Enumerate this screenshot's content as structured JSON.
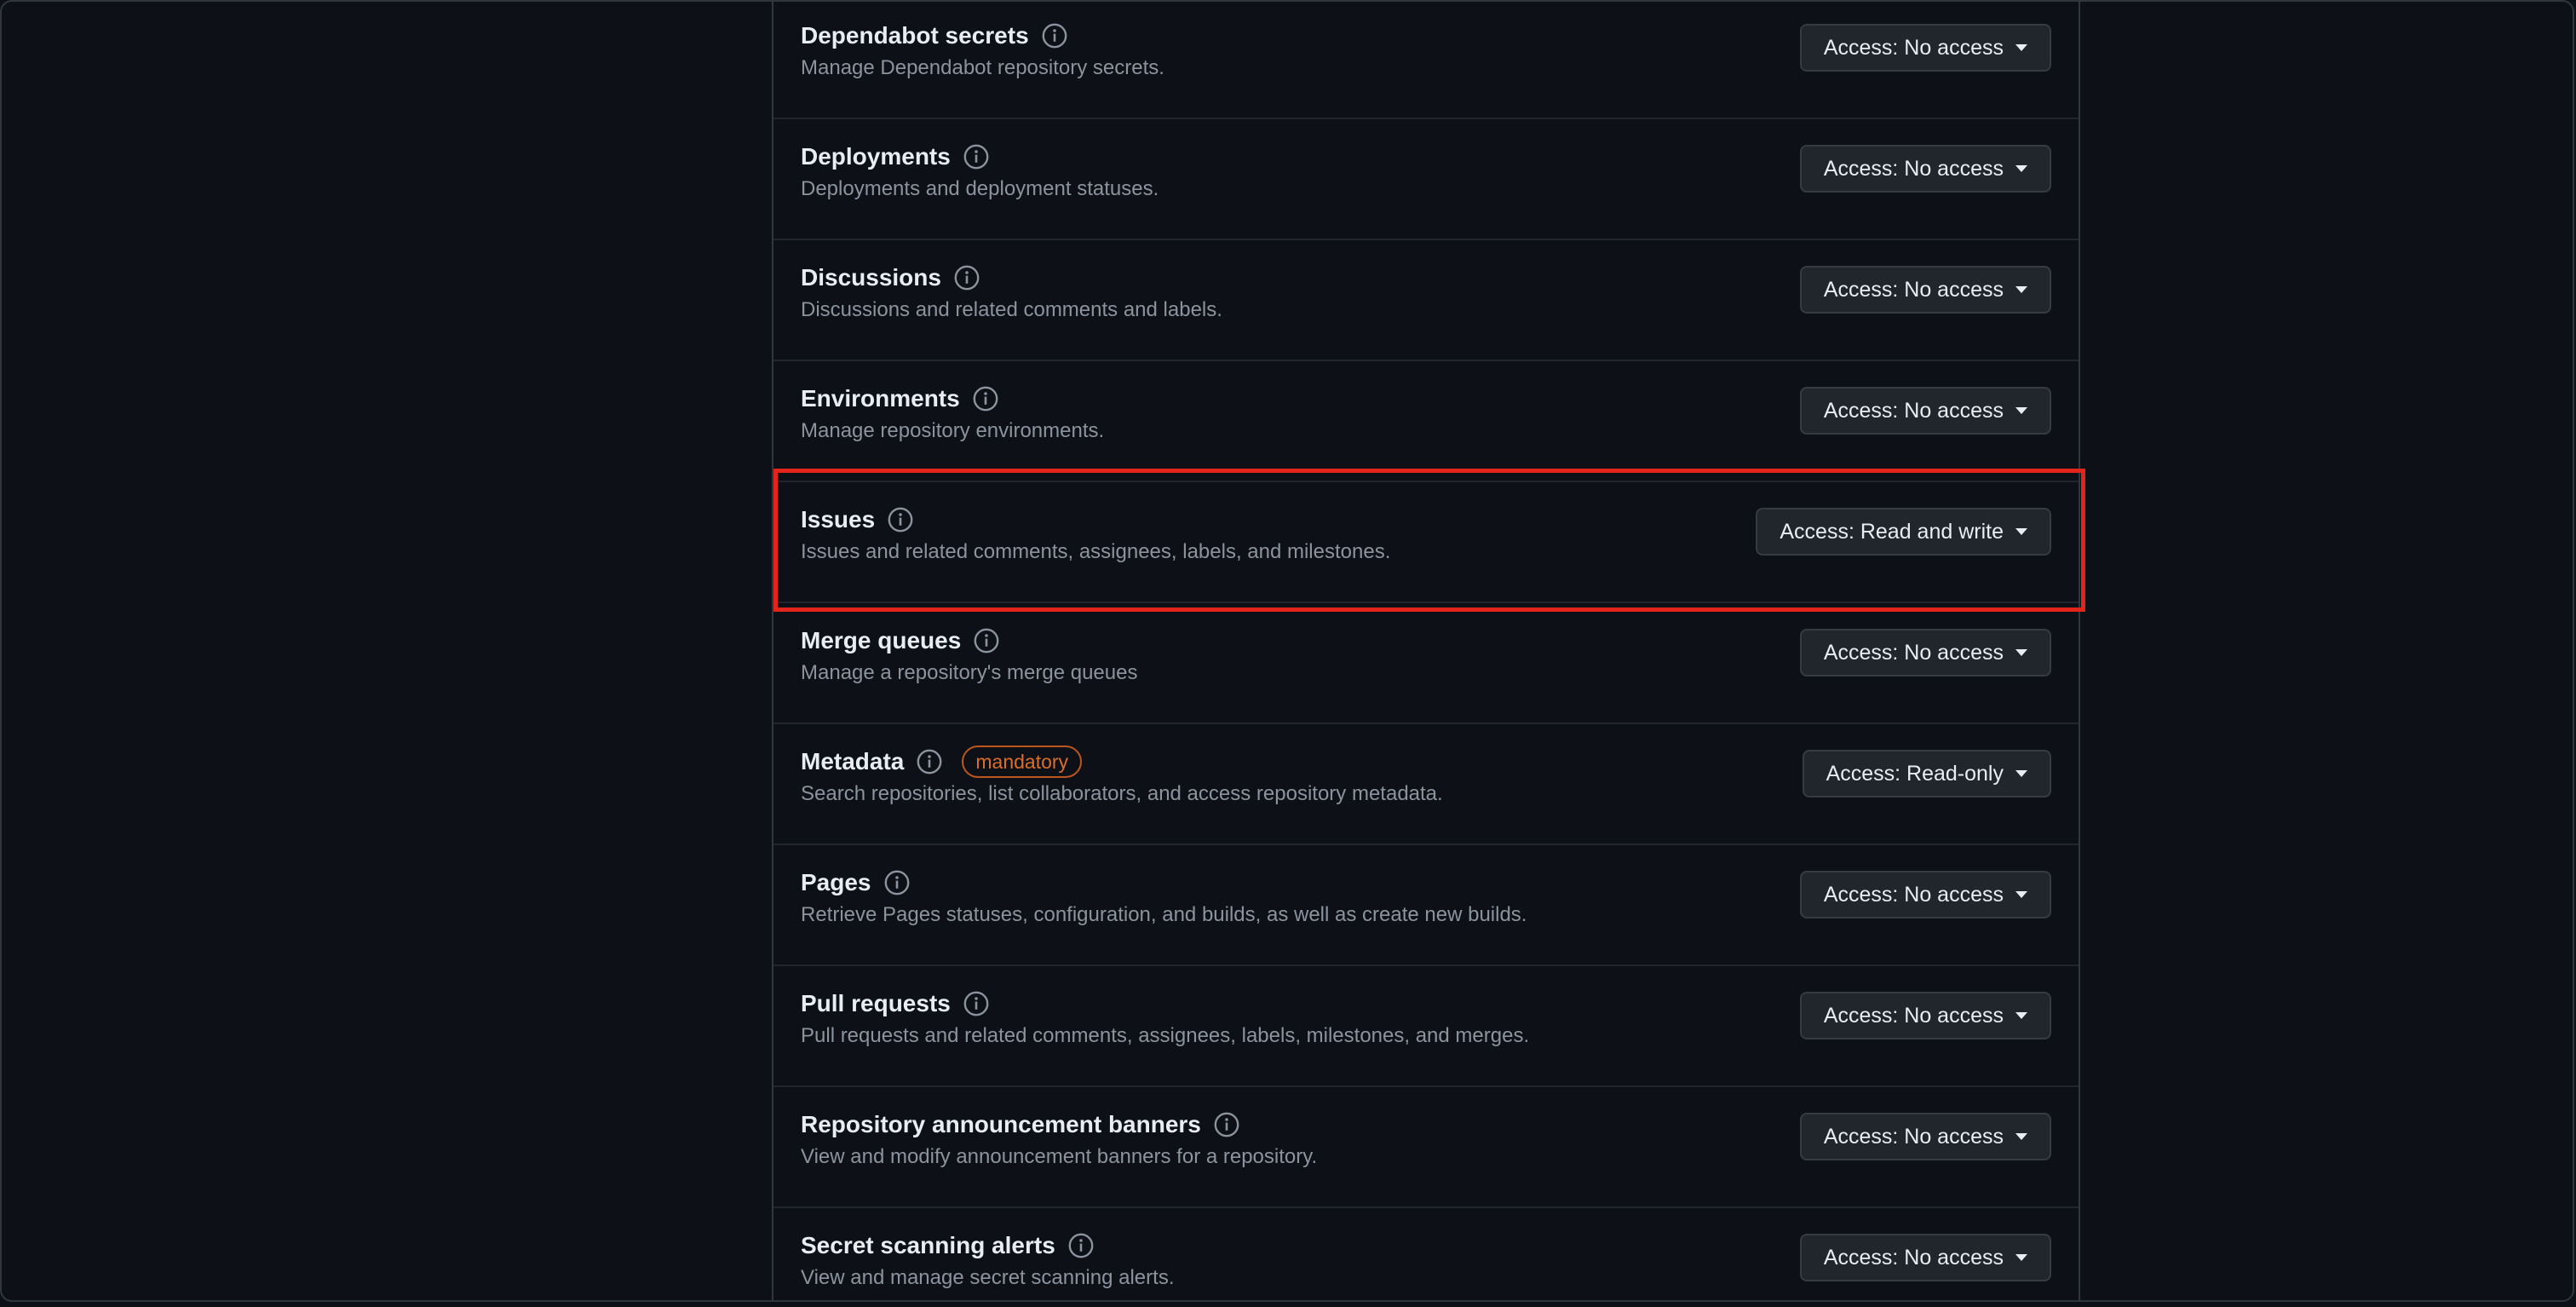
{
  "permissions": [
    {
      "name": "Dependabot secrets",
      "description": "Manage Dependabot repository secrets.",
      "access": "Access: No access",
      "badge": ""
    },
    {
      "name": "Deployments",
      "description": "Deployments and deployment statuses.",
      "access": "Access: No access",
      "badge": ""
    },
    {
      "name": "Discussions",
      "description": "Discussions and related comments and labels.",
      "access": "Access: No access",
      "badge": ""
    },
    {
      "name": "Environments",
      "description": "Manage repository environments.",
      "access": "Access: No access",
      "badge": ""
    },
    {
      "name": "Issues",
      "description": "Issues and related comments, assignees, labels, and milestones.",
      "access": "Access: Read and write",
      "badge": "",
      "highlighted": true
    },
    {
      "name": "Merge queues",
      "description": "Manage a repository's merge queues",
      "access": "Access: No access",
      "badge": ""
    },
    {
      "name": "Metadata",
      "description": "Search repositories, list collaborators, and access repository metadata.",
      "access": "Access: Read-only",
      "badge": "mandatory"
    },
    {
      "name": "Pages",
      "description": "Retrieve Pages statuses, configuration, and builds, as well as create new builds.",
      "access": "Access: No access",
      "badge": ""
    },
    {
      "name": "Pull requests",
      "description": "Pull requests and related comments, assignees, labels, milestones, and merges.",
      "access": "Access: No access",
      "badge": ""
    },
    {
      "name": "Repository announcement banners",
      "description": "View and modify announcement banners for a repository.",
      "access": "Access: No access",
      "badge": ""
    },
    {
      "name": "Secret scanning alerts",
      "description": "View and manage secret scanning alerts.",
      "access": "Access: No access",
      "badge": ""
    }
  ],
  "colors": {
    "background": "#0d1117",
    "highlight": "#e3241b",
    "badge": "#db6d28"
  },
  "icons": {
    "info": "info-icon",
    "dropdown": "caret-down-icon"
  }
}
